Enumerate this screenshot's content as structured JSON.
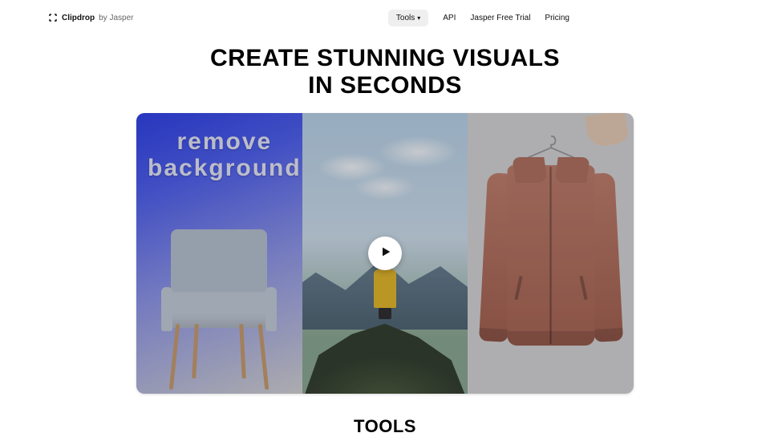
{
  "header": {
    "logo_name": "Clipdrop",
    "logo_by": "by Jasper",
    "nav": {
      "tools": "Tools",
      "api": "API",
      "trial": "Jasper Free Trial",
      "pricing": "Pricing"
    }
  },
  "hero": {
    "line1": "CREATE STUNNING VISUALS",
    "line2": "IN SECONDS",
    "panel1_line1": "remove",
    "panel1_line2": "background"
  },
  "sections": {
    "tools_heading": "TOOLS"
  }
}
